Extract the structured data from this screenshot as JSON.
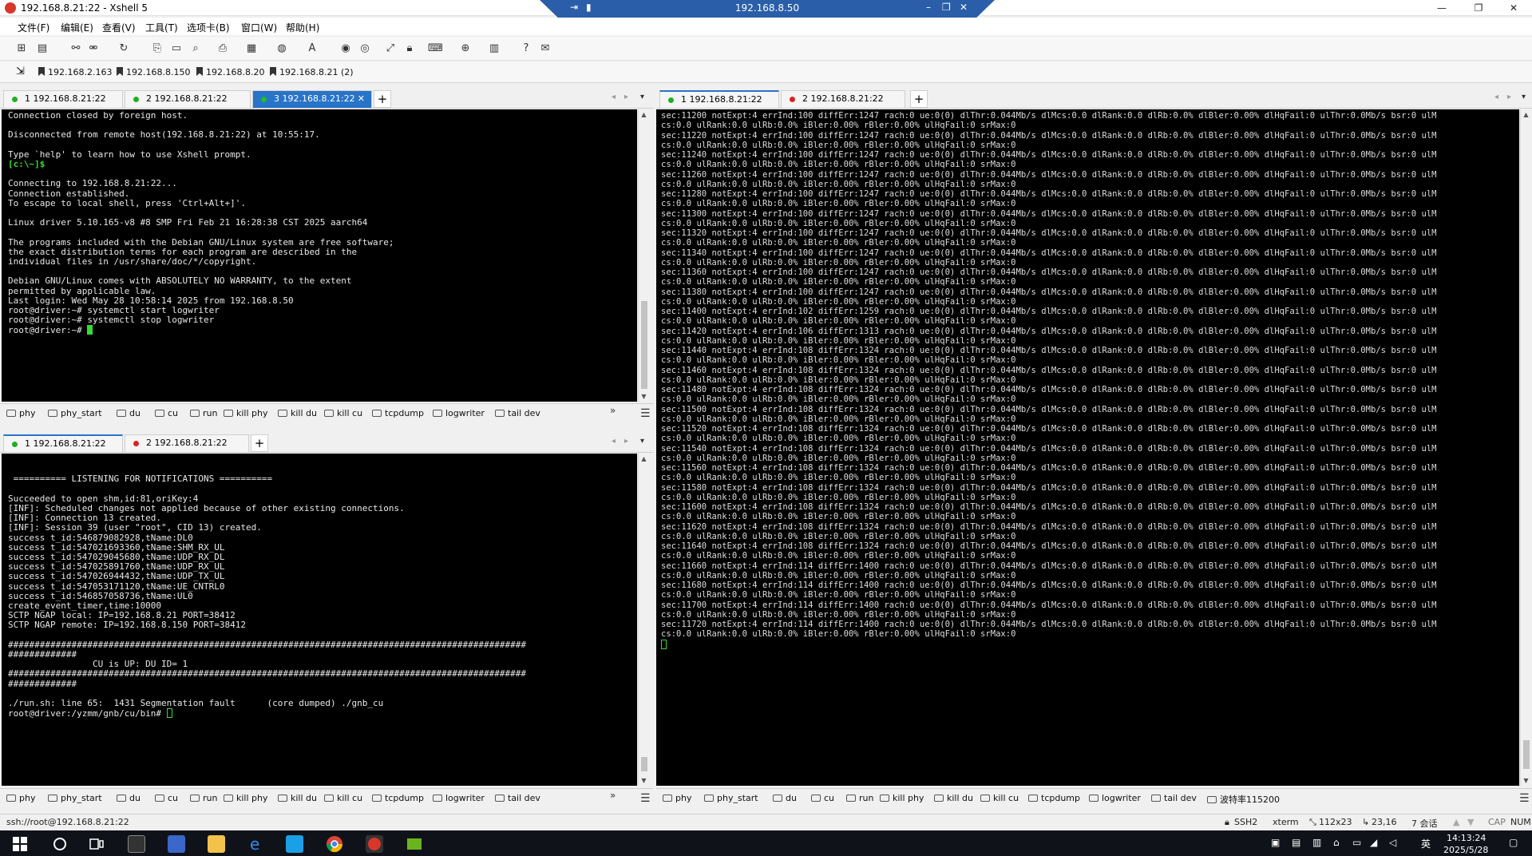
{
  "window": {
    "title": "192.168.8.21:22 - Xshell 5",
    "remote_title": "192.168.8.50",
    "min": "—",
    "max": "❐",
    "close": "✕"
  },
  "menu": [
    "文件(F)",
    "编辑(E)",
    "查看(V)",
    "工具(T)",
    "选项卡(B)",
    "窗口(W)",
    "帮助(H)"
  ],
  "links": [
    "192.168.2.163",
    "192.168.8.150",
    "192.168.8.20",
    "192.168.8.21 (2)"
  ],
  "top_left": {
    "tabs": [
      {
        "label": "1 192.168.8.21:22",
        "dot": "#20b020"
      },
      {
        "label": "2 192.168.8.21:22",
        "dot": "#20b020"
      },
      {
        "label": "3 192.168.8.21:22",
        "dot": "#20c020"
      }
    ],
    "lines": [
      "Connection closed by foreign host.",
      "",
      "Disconnected from remote host(192.168.8.21:22) at 10:55:17.",
      "",
      "Type `help' to learn how to use Xshell prompt.",
      "[c:\\~]$",
      "",
      "Connecting to 192.168.8.21:22...",
      "Connection established.",
      "To escape to local shell, press 'Ctrl+Alt+]'.",
      "",
      "Linux driver 5.10.165-v8 #8 SMP Fri Feb 21 16:28:38 CST 2025 aarch64",
      "",
      "The programs included with the Debian GNU/Linux system are free software;",
      "the exact distribution terms for each program are described in the",
      "individual files in /usr/share/doc/*/copyright.",
      "",
      "Debian GNU/Linux comes with ABSOLUTELY NO WARRANTY, to the extent",
      "permitted by applicable law.",
      "Last login: Wed May 28 10:58:14 2025 from 192.168.8.50",
      "root@driver:~# systemctl start logwriter",
      "root@driver:~# systemctl stop logwriter",
      "root@driver:~# "
    ]
  },
  "bottom_left": {
    "tabs": [
      {
        "label": "1 192.168.8.21:22",
        "dot": "#20b020"
      },
      {
        "label": "2 192.168.8.21:22",
        "dot": "#e02020"
      }
    ],
    "lines": [
      "",
      "",
      " ========== LISTENING FOR NOTIFICATIONS ==========",
      "",
      "Succeeded to open shm,id:81,oriKey:4",
      "[INF]: Scheduled changes not applied because of other existing connections.",
      "[INF]: Connection 13 created.",
      "[INF]: Session 39 (user \"root\", CID 13) created.",
      "success t_id:546879082928,tName:DL0",
      "success t_id:547021693360,tName:SHM_RX_UL",
      "success t_id:547029045680,tName:UDP_RX_DL",
      "success t_id:547025891760,tName:UDP_RX_UL",
      "success t_id:547026944432,tName:UDP_TX_UL",
      "success t_id:547053171120,tName:UE_CNTRL0",
      "success t_id:546857058736,tName:UL0",
      "create_event_timer,time:10000",
      "SCTP NGAP local: IP=192.168.8.21 PORT=38412",
      "SCTP NGAP remote: IP=192.168.8.150 PORT=38412",
      "",
      "##################################################################################################",
      "#############",
      "                CU is UP: DU ID= 1",
      "##################################################################################################",
      "#############",
      "",
      "./run.sh: line 65:  1431 Segmentation fault      (core dumped) ./gnb_cu",
      "root@driver:/yzmm/gnb/cu/bin# "
    ]
  },
  "right": {
    "tabs": [
      {
        "label": "1 192.168.8.21:22",
        "dot": "#20b020"
      },
      {
        "label": "2 192.168.8.21:22",
        "dot": "#e02020"
      }
    ],
    "lines": [
      "sec:11200 notExpt:4 errInd:100 diffErr:1247 rach:0 ue:0(0) dlThr:0.044Mb/s dlMcs:0.0 dlRank:0.0 dlRb:0.0% dlBler:0.00% dlHqFail:0 ulThr:0.0Mb/s bsr:0 ulM",
      "cs:0.0 ulRank:0.0 ulRb:0.0% iBler:0.00% rBler:0.00% ulHqFail:0 srMax:0",
      "sec:11220 notExpt:4 errInd:100 diffErr:1247 rach:0 ue:0(0) dlThr:0.044Mb/s dlMcs:0.0 dlRank:0.0 dlRb:0.0% dlBler:0.00% dlHqFail:0 ulThr:0.0Mb/s bsr:0 ulM",
      "cs:0.0 ulRank:0.0 ulRb:0.0% iBler:0.00% rBler:0.00% ulHqFail:0 srMax:0",
      "sec:11240 notExpt:4 errInd:100 diffErr:1247 rach:0 ue:0(0) dlThr:0.044Mb/s dlMcs:0.0 dlRank:0.0 dlRb:0.0% dlBler:0.00% dlHqFail:0 ulThr:0.0Mb/s bsr:0 ulM",
      "cs:0.0 ulRank:0.0 ulRb:0.0% iBler:0.00% rBler:0.00% ulHqFail:0 srMax:0",
      "sec:11260 notExpt:4 errInd:100 diffErr:1247 rach:0 ue:0(0) dlThr:0.044Mb/s dlMcs:0.0 dlRank:0.0 dlRb:0.0% dlBler:0.00% dlHqFail:0 ulThr:0.0Mb/s bsr:0 ulM",
      "cs:0.0 ulRank:0.0 ulRb:0.0% iBler:0.00% rBler:0.00% ulHqFail:0 srMax:0",
      "sec:11280 notExpt:4 errInd:100 diffErr:1247 rach:0 ue:0(0) dlThr:0.044Mb/s dlMcs:0.0 dlRank:0.0 dlRb:0.0% dlBler:0.00% dlHqFail:0 ulThr:0.0Mb/s bsr:0 ulM",
      "cs:0.0 ulRank:0.0 ulRb:0.0% iBler:0.00% rBler:0.00% ulHqFail:0 srMax:0",
      "sec:11300 notExpt:4 errInd:100 diffErr:1247 rach:0 ue:0(0) dlThr:0.044Mb/s dlMcs:0.0 dlRank:0.0 dlRb:0.0% dlBler:0.00% dlHqFail:0 ulThr:0.0Mb/s bsr:0 ulM",
      "cs:0.0 ulRank:0.0 ulRb:0.0% iBler:0.00% rBler:0.00% ulHqFail:0 srMax:0",
      "sec:11320 notExpt:4 errInd:100 diffErr:1247 rach:0 ue:0(0) dlThr:0.044Mb/s dlMcs:0.0 dlRank:0.0 dlRb:0.0% dlBler:0.00% dlHqFail:0 ulThr:0.0Mb/s bsr:0 ulM",
      "cs:0.0 ulRank:0.0 ulRb:0.0% iBler:0.00% rBler:0.00% ulHqFail:0 srMax:0",
      "sec:11340 notExpt:4 errInd:100 diffErr:1247 rach:0 ue:0(0) dlThr:0.044Mb/s dlMcs:0.0 dlRank:0.0 dlRb:0.0% dlBler:0.00% dlHqFail:0 ulThr:0.0Mb/s bsr:0 ulM",
      "cs:0.0 ulRank:0.0 ulRb:0.0% iBler:0.00% rBler:0.00% ulHqFail:0 srMax:0",
      "sec:11360 notExpt:4 errInd:100 diffErr:1247 rach:0 ue:0(0) dlThr:0.044Mb/s dlMcs:0.0 dlRank:0.0 dlRb:0.0% dlBler:0.00% dlHqFail:0 ulThr:0.0Mb/s bsr:0 ulM",
      "cs:0.0 ulRank:0.0 ulRb:0.0% iBler:0.00% rBler:0.00% ulHqFail:0 srMax:0",
      "sec:11380 notExpt:4 errInd:100 diffErr:1247 rach:0 ue:0(0) dlThr:0.044Mb/s dlMcs:0.0 dlRank:0.0 dlRb:0.0% dlBler:0.00% dlHqFail:0 ulThr:0.0Mb/s bsr:0 ulM",
      "cs:0.0 ulRank:0.0 ulRb:0.0% iBler:0.00% rBler:0.00% ulHqFail:0 srMax:0",
      "sec:11400 notExpt:4 errInd:102 diffErr:1259 rach:0 ue:0(0) dlThr:0.044Mb/s dlMcs:0.0 dlRank:0.0 dlRb:0.0% dlBler:0.00% dlHqFail:0 ulThr:0.0Mb/s bsr:0 ulM",
      "cs:0.0 ulRank:0.0 ulRb:0.0% iBler:0.00% rBler:0.00% ulHqFail:0 srMax:0",
      "sec:11420 notExpt:4 errInd:106 diffErr:1313 rach:0 ue:0(0) dlThr:0.044Mb/s dlMcs:0.0 dlRank:0.0 dlRb:0.0% dlBler:0.00% dlHqFail:0 ulThr:0.0Mb/s bsr:0 ulM",
      "cs:0.0 ulRank:0.0 ulRb:0.0% iBler:0.00% rBler:0.00% ulHqFail:0 srMax:0",
      "sec:11440 notExpt:4 errInd:108 diffErr:1324 rach:0 ue:0(0) dlThr:0.044Mb/s dlMcs:0.0 dlRank:0.0 dlRb:0.0% dlBler:0.00% dlHqFail:0 ulThr:0.0Mb/s bsr:0 ulM",
      "cs:0.0 ulRank:0.0 ulRb:0.0% iBler:0.00% rBler:0.00% ulHqFail:0 srMax:0",
      "sec:11460 notExpt:4 errInd:108 diffErr:1324 rach:0 ue:0(0) dlThr:0.044Mb/s dlMcs:0.0 dlRank:0.0 dlRb:0.0% dlBler:0.00% dlHqFail:0 ulThr:0.0Mb/s bsr:0 ulM",
      "cs:0.0 ulRank:0.0 ulRb:0.0% iBler:0.00% rBler:0.00% ulHqFail:0 srMax:0",
      "sec:11480 notExpt:4 errInd:108 diffErr:1324 rach:0 ue:0(0) dlThr:0.044Mb/s dlMcs:0.0 dlRank:0.0 dlRb:0.0% dlBler:0.00% dlHqFail:0 ulThr:0.0Mb/s bsr:0 ulM",
      "cs:0.0 ulRank:0.0 ulRb:0.0% iBler:0.00% rBler:0.00% ulHqFail:0 srMax:0",
      "sec:11500 notExpt:4 errInd:108 diffErr:1324 rach:0 ue:0(0) dlThr:0.044Mb/s dlMcs:0.0 dlRank:0.0 dlRb:0.0% dlBler:0.00% dlHqFail:0 ulThr:0.0Mb/s bsr:0 ulM",
      "cs:0.0 ulRank:0.0 ulRb:0.0% iBler:0.00% rBler:0.00% ulHqFail:0 srMax:0",
      "sec:11520 notExpt:4 errInd:108 diffErr:1324 rach:0 ue:0(0) dlThr:0.044Mb/s dlMcs:0.0 dlRank:0.0 dlRb:0.0% dlBler:0.00% dlHqFail:0 ulThr:0.0Mb/s bsr:0 ulM",
      "cs:0.0 ulRank:0.0 ulRb:0.0% iBler:0.00% rBler:0.00% ulHqFail:0 srMax:0",
      "sec:11540 notExpt:4 errInd:108 diffErr:1324 rach:0 ue:0(0) dlThr:0.044Mb/s dlMcs:0.0 dlRank:0.0 dlRb:0.0% dlBler:0.00% dlHqFail:0 ulThr:0.0Mb/s bsr:0 ulM",
      "cs:0.0 ulRank:0.0 ulRb:0.0% iBler:0.00% rBler:0.00% ulHqFail:0 srMax:0",
      "sec:11560 notExpt:4 errInd:108 diffErr:1324 rach:0 ue:0(0) dlThr:0.044Mb/s dlMcs:0.0 dlRank:0.0 dlRb:0.0% dlBler:0.00% dlHqFail:0 ulThr:0.0Mb/s bsr:0 ulM",
      "cs:0.0 ulRank:0.0 ulRb:0.0% iBler:0.00% rBler:0.00% ulHqFail:0 srMax:0",
      "sec:11580 notExpt:4 errInd:108 diffErr:1324 rach:0 ue:0(0) dlThr:0.044Mb/s dlMcs:0.0 dlRank:0.0 dlRb:0.0% dlBler:0.00% dlHqFail:0 ulThr:0.0Mb/s bsr:0 ulM",
      "cs:0.0 ulRank:0.0 ulRb:0.0% iBler:0.00% rBler:0.00% ulHqFail:0 srMax:0",
      "sec:11600 notExpt:4 errInd:108 diffErr:1324 rach:0 ue:0(0) dlThr:0.044Mb/s dlMcs:0.0 dlRank:0.0 dlRb:0.0% dlBler:0.00% dlHqFail:0 ulThr:0.0Mb/s bsr:0 ulM",
      "cs:0.0 ulRank:0.0 ulRb:0.0% iBler:0.00% rBler:0.00% ulHqFail:0 srMax:0",
      "sec:11620 notExpt:4 errInd:108 diffErr:1324 rach:0 ue:0(0) dlThr:0.044Mb/s dlMcs:0.0 dlRank:0.0 dlRb:0.0% dlBler:0.00% dlHqFail:0 ulThr:0.0Mb/s bsr:0 ulM",
      "cs:0.0 ulRank:0.0 ulRb:0.0% iBler:0.00% rBler:0.00% ulHqFail:0 srMax:0",
      "sec:11640 notExpt:4 errInd:108 diffErr:1324 rach:0 ue:0(0) dlThr:0.044Mb/s dlMcs:0.0 dlRank:0.0 dlRb:0.0% dlBler:0.00% dlHqFail:0 ulThr:0.0Mb/s bsr:0 ulM",
      "cs:0.0 ulRank:0.0 ulRb:0.0% iBler:0.00% rBler:0.00% ulHqFail:0 srMax:0",
      "sec:11660 notExpt:4 errInd:114 diffErr:1400 rach:0 ue:0(0) dlThr:0.044Mb/s dlMcs:0.0 dlRank:0.0 dlRb:0.0% dlBler:0.00% dlHqFail:0 ulThr:0.0Mb/s bsr:0 ulM",
      "cs:0.0 ulRank:0.0 ulRb:0.0% iBler:0.00% rBler:0.00% ulHqFail:0 srMax:0",
      "sec:11680 notExpt:4 errInd:114 diffErr:1400 rach:0 ue:0(0) dlThr:0.044Mb/s dlMcs:0.0 dlRank:0.0 dlRb:0.0% dlBler:0.00% dlHqFail:0 ulThr:0.0Mb/s bsr:0 ulM",
      "cs:0.0 ulRank:0.0 ulRb:0.0% iBler:0.00% rBler:0.00% ulHqFail:0 srMax:0",
      "sec:11700 notExpt:4 errInd:114 diffErr:1400 rach:0 ue:0(0) dlThr:0.044Mb/s dlMcs:0.0 dlRank:0.0 dlRb:0.0% dlBler:0.00% dlHqFail:0 ulThr:0.0Mb/s bsr:0 ulM",
      "cs:0.0 ulRank:0.0 ulRb:0.0% iBler:0.00% rBler:0.00% ulHqFail:0 srMax:0",
      "sec:11720 notExpt:4 errInd:114 diffErr:1400 rach:0 ue:0(0) dlThr:0.044Mb/s dlMcs:0.0 dlRank:0.0 dlRb:0.0% dlBler:0.00% dlHqFail:0 ulThr:0.0Mb/s bsr:0 ulM",
      "cs:0.0 ulRank:0.0 ulRb:0.0% iBler:0.00% rBler:0.00% ulHqFail:0 srMax:0",
      ""
    ]
  },
  "quickbar": [
    "phy",
    "phy_start",
    "du",
    "cu",
    "run",
    "kill phy",
    "kill du",
    "kill cu",
    "tcpdump",
    "logwriter",
    "tail dev"
  ],
  "quickbar_right_extra": "波特率115200",
  "status": {
    "left": "ssh://root@192.168.8.21:22",
    "protocol": "SSH2",
    "term": "xterm",
    "size": "112x23",
    "pos": "23,16",
    "sessions": "7 会话",
    "cap": "CAP",
    "num": "NUM"
  },
  "taskbar": {
    "time": "14:13:24",
    "date": "2025/5/28",
    "lang": "英"
  },
  "colors": {
    "accent": "#2874c8",
    "terminal_bg": "#000000",
    "prompt": "#33dd33"
  }
}
